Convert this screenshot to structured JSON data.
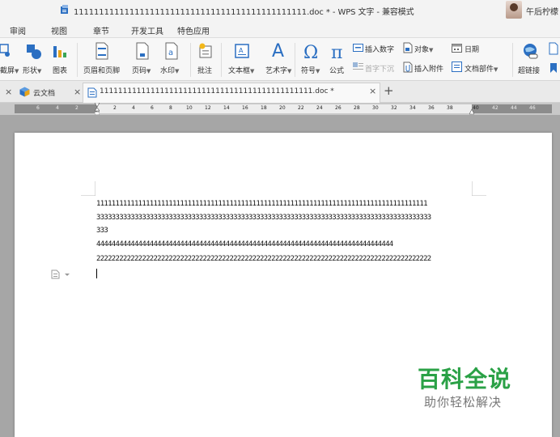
{
  "window": {
    "title": "1111111111111111111111111111111111111111111111.doc * - WPS 文字 - 兼容模式",
    "user_name": "午后柠檬"
  },
  "menu": {
    "items": [
      "审阅",
      "视图",
      "章节",
      "开发工具",
      "特色应用"
    ]
  },
  "ribbon": {
    "screenshot_label": "截屏",
    "shape_label": "形状",
    "chart_label": "图表",
    "header_footer_label": "页眉和页脚",
    "page_number_label": "页码",
    "watermark_label": "水印",
    "comment_label": "批注",
    "textbox_label": "文本框",
    "wordart_label": "艺术字",
    "symbol_label": "符号",
    "formula_label": "公式",
    "insert_number_label": "插入数字",
    "object_label": "对象",
    "date_label": "日期",
    "drop_cap_label": "首字下沉",
    "attachment_label": "插入附件",
    "doc_parts_label": "文档部件",
    "hyperlink_label": "超链接"
  },
  "tabs": {
    "cloud_label": "云文档",
    "doc_label": "1111111111111111111111111111111111111111111111.doc *",
    "close_symbol": "×",
    "new_tab_symbol": "+"
  },
  "ruler": {
    "left_numbers": [
      "6",
      "4",
      "2"
    ],
    "numbers": [
      "2",
      "4",
      "6",
      "8",
      "10",
      "12",
      "14",
      "16",
      "18",
      "20",
      "22",
      "24",
      "26",
      "28",
      "30",
      "32",
      "34",
      "36",
      "38"
    ],
    "right_numbers": [
      "40",
      "42",
      "44",
      "46"
    ]
  },
  "document": {
    "lines": [
      "111111111111111111111111111111111111111111111111111111111111111111111111111111111111111",
      "3333333333333333333333333333333333333333333333333333333333333333333333333333333333333333",
      "333",
      "444444444444444444444444444444444444444444444444444444444444444444444444444444",
      "2222222222222222222222222222222222222222222222222222222222222222222222222222222222222222"
    ]
  },
  "watermark": {
    "title": "百科全说",
    "subtitle": "助你轻松解决"
  },
  "colors": {
    "accent_blue": "#2b6fc2",
    "watermark_green": "#2aa146"
  }
}
